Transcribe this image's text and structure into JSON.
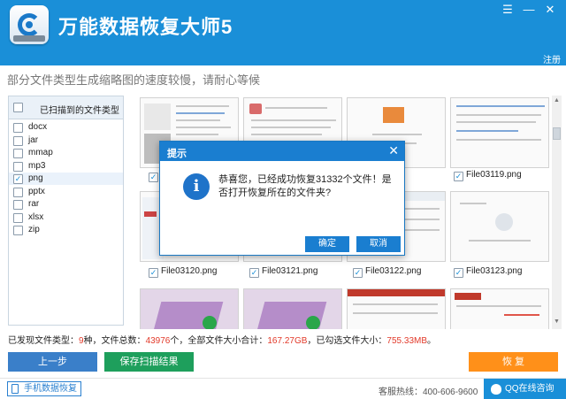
{
  "app": {
    "title": "万能数据恢复大师5",
    "register": "注册",
    "window_controls": [
      "menu",
      "minimize",
      "close"
    ]
  },
  "notice": "部分文件类型生成缩略图的速度较慢，请耐心等候",
  "file_types": {
    "header": "已扫描到的文件类型",
    "items": [
      {
        "label": "docx",
        "checked": false
      },
      {
        "label": "jar",
        "checked": false
      },
      {
        "label": "mmap",
        "checked": false
      },
      {
        "label": "mp3",
        "checked": false
      },
      {
        "label": "png",
        "checked": true
      },
      {
        "label": "pptx",
        "checked": false
      },
      {
        "label": "rar",
        "checked": false
      },
      {
        "label": "xlsx",
        "checked": false
      },
      {
        "label": "zip",
        "checked": false
      }
    ]
  },
  "thumbnails": {
    "row1": [
      "",
      "",
      "",
      "File03119.png"
    ],
    "row2": [
      "File03120.png",
      "File03121.png",
      "File03122.png",
      "File03123.png"
    ]
  },
  "stats": {
    "p1": "已发现文件类型：",
    "types": "9",
    "p2": "种，文件总数：",
    "total": "43976",
    "p3": "个，全部文件大小合计：",
    "size": "167.27GB",
    "p4": "，已勾选文件大小：",
    "selected": "755.33MB",
    "p5": "。"
  },
  "buttons": {
    "prev": "上一步",
    "save_scan": "保存扫描结果",
    "recover": "恢 复"
  },
  "footer": {
    "mobile": "手机数据恢复",
    "hotline": "客服热线：400-606-9600",
    "qq": "QQ在线咨询"
  },
  "dialog": {
    "title": "提示",
    "message": "恭喜您，已经成功恢复31332个文件！是否打开恢复所在的文件夹?",
    "ok": "确定",
    "cancel": "取消"
  },
  "colors": {
    "titlebar": "#1a8fd8",
    "highlight": "#e23a2a",
    "prev_button": "#3a7fc9",
    "save_button": "#1e9f5c",
    "recover_button": "#ff9019",
    "dialog_header": "#1a7ed0"
  }
}
